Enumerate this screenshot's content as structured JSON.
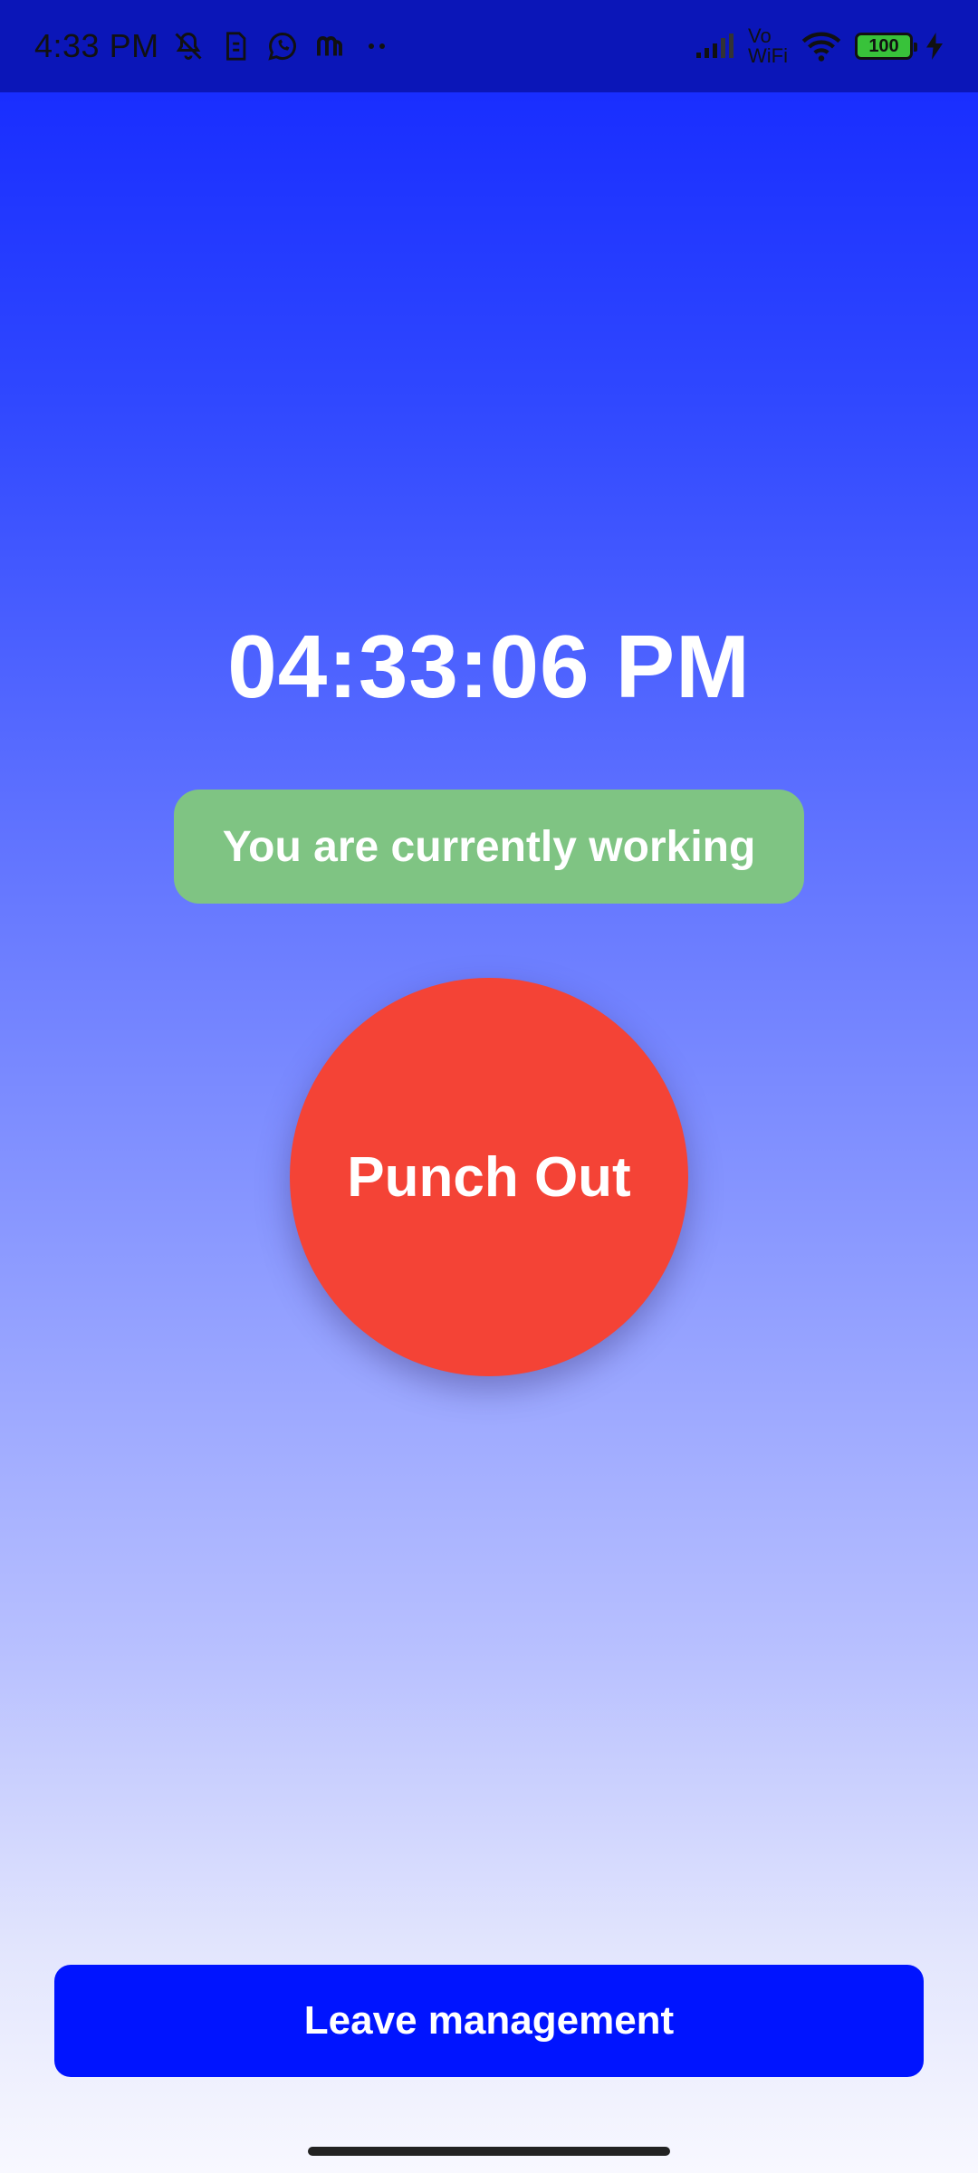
{
  "status_bar": {
    "time": "4:33 PM",
    "icons_left": [
      "bell-off-icon",
      "sim-alert-icon",
      "whatsapp-icon",
      "m-app-icon",
      "more-dots-icon"
    ],
    "network_label_top": "Vo",
    "network_label_bottom": "WiFi",
    "battery_level": "100",
    "colors": {
      "background": "#0b16b8"
    }
  },
  "main": {
    "clock": "04:33:06 PM",
    "status_message": "You are currently working",
    "punch_button_label": "Punch Out",
    "leave_button_label": "Leave management",
    "colors": {
      "status_pill": "#7fc483",
      "punch_button": "#f44336",
      "leave_button": "#0014ff",
      "gradient_top": "#1226ff",
      "gradient_bottom": "#f8f8ff"
    }
  }
}
